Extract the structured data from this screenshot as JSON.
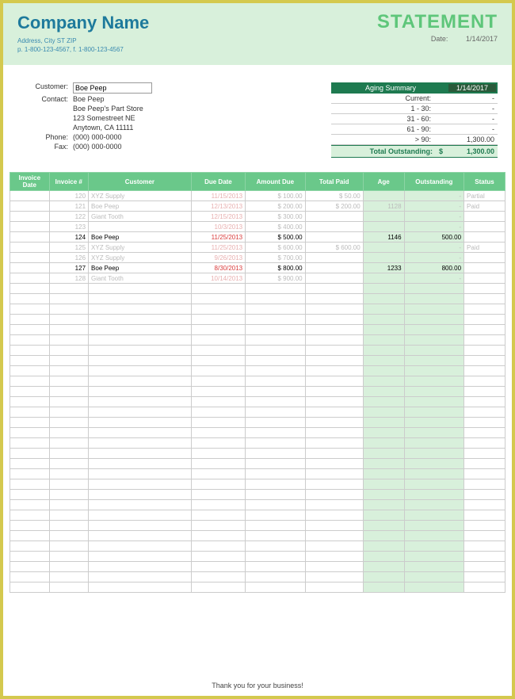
{
  "header": {
    "company_name": "Company Name",
    "address": "Address, City ST ZIP",
    "phones": "p. 1-800-123-4567, f. 1-800-123-4567",
    "statement_title": "STATEMENT",
    "date_label": "Date:",
    "date_value": "1/14/2017"
  },
  "customer": {
    "label_customer": "Customer:",
    "name": "Boe Peep",
    "label_contact": "Contact:",
    "contact": "Boe Peep",
    "store": "Boe Peep's Part Store",
    "street": "123 Somestreet NE",
    "citystate": "Anytown, CA 11111",
    "label_phone": "Phone:",
    "phone": "(000) 000-0000",
    "label_fax": "Fax:",
    "fax": "(000) 000-0000"
  },
  "aging": {
    "title": "Aging Summary",
    "date": "1/14/2017",
    "rows": [
      {
        "label": "Current:",
        "value": "-"
      },
      {
        "label": "1 - 30:",
        "value": "-"
      },
      {
        "label": "31 - 60:",
        "value": "-"
      },
      {
        "label": "61 - 90:",
        "value": "-"
      },
      {
        "label": "> 90:",
        "value": "1,300.00"
      }
    ],
    "total_label": "Total Outstanding:",
    "total_currency": "$",
    "total_value": "1,300.00"
  },
  "table": {
    "headers": [
      "Invoice Date",
      "Invoice #",
      "Customer",
      "Due Date",
      "Amount Due",
      "Total Paid",
      "Age",
      "Outstanding",
      "Status"
    ],
    "rows": [
      {
        "active": false,
        "inv": "120",
        "cust": "XYZ Supply",
        "due": "11/15/2013",
        "amt": "$      100.00",
        "paid": "$       50.00",
        "age": "",
        "out": "-",
        "stat": "Partial"
      },
      {
        "active": false,
        "inv": "121",
        "cust": "Boe Peep",
        "due": "12/13/2013",
        "amt": "$      200.00",
        "paid": "$     200.00",
        "age": "1128",
        "out": "-",
        "stat": "Paid"
      },
      {
        "active": false,
        "inv": "122",
        "cust": "Giant Tooth",
        "due": "12/15/2013",
        "amt": "$      300.00",
        "paid": "",
        "age": "",
        "out": "-",
        "stat": ""
      },
      {
        "active": false,
        "inv": "123",
        "cust": "",
        "due": "10/3/2013",
        "amt": "$      400.00",
        "paid": "",
        "age": "",
        "out": "-",
        "stat": ""
      },
      {
        "active": true,
        "inv": "124",
        "cust": "Boe Peep",
        "due": "11/25/2013",
        "amt": "$      500.00",
        "paid": "",
        "age": "1146",
        "out": "500.00",
        "stat": ""
      },
      {
        "active": false,
        "inv": "125",
        "cust": "XYZ Supply",
        "due": "11/25/2013",
        "amt": "$      600.00",
        "paid": "$     600.00",
        "age": "",
        "out": "-",
        "stat": "Paid"
      },
      {
        "active": false,
        "inv": "126",
        "cust": "XYZ Supply",
        "due": "9/26/2013",
        "amt": "$      700.00",
        "paid": "",
        "age": "",
        "out": "-",
        "stat": ""
      },
      {
        "active": true,
        "inv": "127",
        "cust": "Boe Peep",
        "due": "8/30/2013",
        "amt": "$      800.00",
        "paid": "",
        "age": "1233",
        "out": "800.00",
        "stat": ""
      },
      {
        "active": false,
        "inv": "128",
        "cust": "Giant Tooth",
        "due": "10/14/2013",
        "amt": "$      900.00",
        "paid": "",
        "age": "",
        "out": "-",
        "stat": ""
      }
    ],
    "empty_rows": 30
  },
  "footer": "Thank you for your business!"
}
